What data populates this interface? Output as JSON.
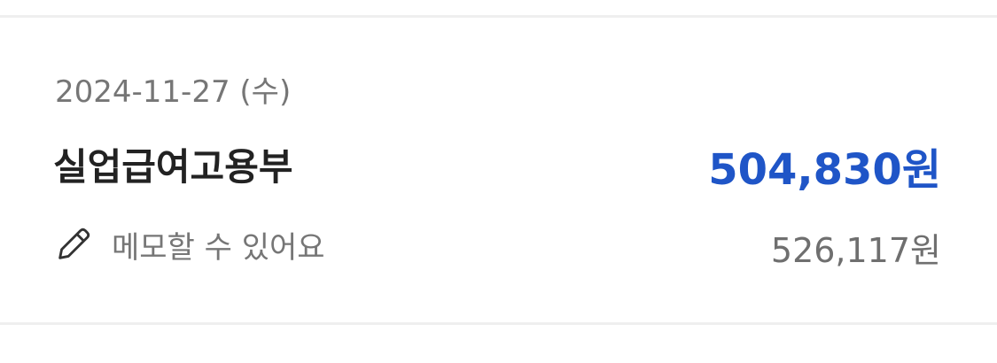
{
  "transaction": {
    "date": "2024-11-27 (수)",
    "title": "실업급여고용부",
    "amount": "504,830원",
    "memo_placeholder": "메모할 수 있어요",
    "balance": "526,117원"
  },
  "colors": {
    "amount": "#1f55c7",
    "title": "#222222",
    "secondary_text": "#767676",
    "divider": "#efefef"
  },
  "icons": {
    "memo": "pencil-icon"
  }
}
